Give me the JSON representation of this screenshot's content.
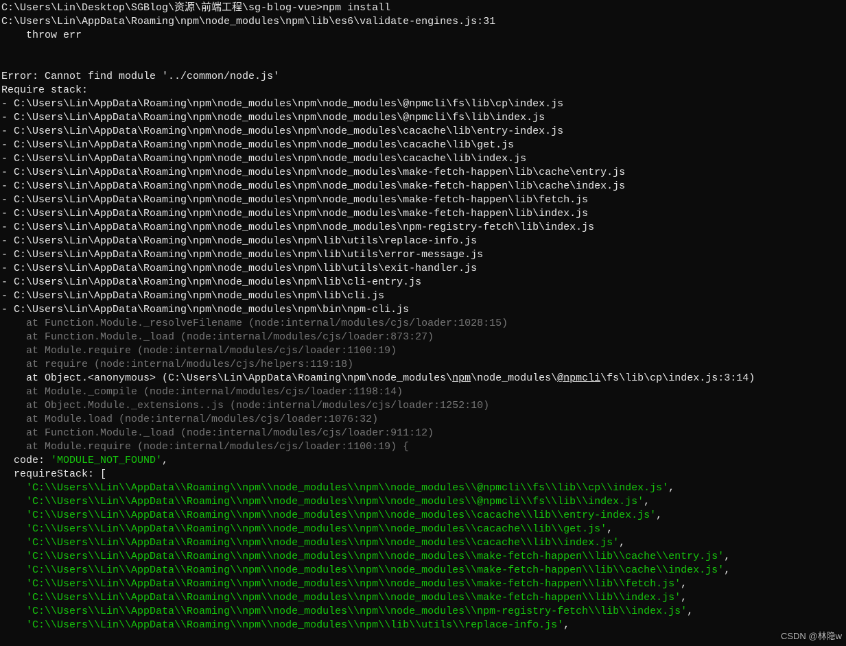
{
  "prompt_path": "C:\\Users\\Lin\\Desktop\\SGBlog\\资源\\前端工程\\sg-blog-vue>",
  "command": "npm install",
  "engine_line": "C:\\Users\\Lin\\AppData\\Roaming\\npm\\node_modules\\npm\\lib\\es6\\validate-engines.js:31",
  "throw_line": "    throw err",
  "error_line": "Error: Cannot find module '../common/node.js'",
  "require_stack_header": "Require stack:",
  "stack_files": [
    "- C:\\Users\\Lin\\AppData\\Roaming\\npm\\node_modules\\npm\\node_modules\\@npmcli\\fs\\lib\\cp\\index.js",
    "- C:\\Users\\Lin\\AppData\\Roaming\\npm\\node_modules\\npm\\node_modules\\@npmcli\\fs\\lib\\index.js",
    "- C:\\Users\\Lin\\AppData\\Roaming\\npm\\node_modules\\npm\\node_modules\\cacache\\lib\\entry-index.js",
    "- C:\\Users\\Lin\\AppData\\Roaming\\npm\\node_modules\\npm\\node_modules\\cacache\\lib\\get.js",
    "- C:\\Users\\Lin\\AppData\\Roaming\\npm\\node_modules\\npm\\node_modules\\cacache\\lib\\index.js",
    "- C:\\Users\\Lin\\AppData\\Roaming\\npm\\node_modules\\npm\\node_modules\\make-fetch-happen\\lib\\cache\\entry.js",
    "- C:\\Users\\Lin\\AppData\\Roaming\\npm\\node_modules\\npm\\node_modules\\make-fetch-happen\\lib\\cache\\index.js",
    "- C:\\Users\\Lin\\AppData\\Roaming\\npm\\node_modules\\npm\\node_modules\\make-fetch-happen\\lib\\fetch.js",
    "- C:\\Users\\Lin\\AppData\\Roaming\\npm\\node_modules\\npm\\node_modules\\make-fetch-happen\\lib\\index.js",
    "- C:\\Users\\Lin\\AppData\\Roaming\\npm\\node_modules\\npm\\node_modules\\npm-registry-fetch\\lib\\index.js",
    "- C:\\Users\\Lin\\AppData\\Roaming\\npm\\node_modules\\npm\\lib\\utils\\replace-info.js",
    "- C:\\Users\\Lin\\AppData\\Roaming\\npm\\node_modules\\npm\\lib\\utils\\error-message.js",
    "- C:\\Users\\Lin\\AppData\\Roaming\\npm\\node_modules\\npm\\lib\\utils\\exit-handler.js",
    "- C:\\Users\\Lin\\AppData\\Roaming\\npm\\node_modules\\npm\\lib\\cli-entry.js",
    "- C:\\Users\\Lin\\AppData\\Roaming\\npm\\node_modules\\npm\\lib\\cli.js",
    "- C:\\Users\\Lin\\AppData\\Roaming\\npm\\node_modules\\npm\\bin\\npm-cli.js"
  ],
  "trace": [
    "    at Function.Module._resolveFilename (node:internal/modules/cjs/loader:1028:15)",
    "    at Function.Module._load (node:internal/modules/cjs/loader:873:27)",
    "    at Module.require (node:internal/modules/cjs/loader:1100:19)",
    "    at require (node:internal/modules/cjs/helpers:119:18)"
  ],
  "anon": {
    "pre": "    at Object.<anonymous> (C:\\Users\\Lin\\AppData\\Roaming\\npm\\node_modules\\",
    "link1": "npm",
    "mid": "\\node_modules\\",
    "link2": "@npmcli",
    "post": "\\fs\\lib\\cp\\index.js:3:14)"
  },
  "trace2": [
    "    at Module._compile (node:internal/modules/cjs/loader:1198:14)",
    "    at Object.Module._extensions..js (node:internal/modules/cjs/loader:1252:10)",
    "    at Module.load (node:internal/modules/cjs/loader:1076:32)",
    "    at Function.Module._load (node:internal/modules/cjs/loader:911:12)",
    "    at Module.require (node:internal/modules/cjs/loader:1100:19) {"
  ],
  "code_label": "  code: ",
  "code_value": "'MODULE_NOT_FOUND'",
  "code_tail": ",",
  "require_stack_line": "  requireStack: [",
  "require_stack_items": [
    "'C:\\\\Users\\\\Lin\\\\AppData\\\\Roaming\\\\npm\\\\node_modules\\\\npm\\\\node_modules\\\\@npmcli\\\\fs\\\\lib\\\\cp\\\\index.js'",
    "'C:\\\\Users\\\\Lin\\\\AppData\\\\Roaming\\\\npm\\\\node_modules\\\\npm\\\\node_modules\\\\@npmcli\\\\fs\\\\lib\\\\index.js'",
    "'C:\\\\Users\\\\Lin\\\\AppData\\\\Roaming\\\\npm\\\\node_modules\\\\npm\\\\node_modules\\\\cacache\\\\lib\\\\entry-index.js'",
    "'C:\\\\Users\\\\Lin\\\\AppData\\\\Roaming\\\\npm\\\\node_modules\\\\npm\\\\node_modules\\\\cacache\\\\lib\\\\get.js'",
    "'C:\\\\Users\\\\Lin\\\\AppData\\\\Roaming\\\\npm\\\\node_modules\\\\npm\\\\node_modules\\\\cacache\\\\lib\\\\index.js'",
    "'C:\\\\Users\\\\Lin\\\\AppData\\\\Roaming\\\\npm\\\\node_modules\\\\npm\\\\node_modules\\\\make-fetch-happen\\\\lib\\\\cache\\\\entry.js'",
    "'C:\\\\Users\\\\Lin\\\\AppData\\\\Roaming\\\\npm\\\\node_modules\\\\npm\\\\node_modules\\\\make-fetch-happen\\\\lib\\\\cache\\\\index.js'",
    "'C:\\\\Users\\\\Lin\\\\AppData\\\\Roaming\\\\npm\\\\node_modules\\\\npm\\\\node_modules\\\\make-fetch-happen\\\\lib\\\\fetch.js'",
    "'C:\\\\Users\\\\Lin\\\\AppData\\\\Roaming\\\\npm\\\\node_modules\\\\npm\\\\node_modules\\\\make-fetch-happen\\\\lib\\\\index.js'",
    "'C:\\\\Users\\\\Lin\\\\AppData\\\\Roaming\\\\npm\\\\node_modules\\\\npm\\\\node_modules\\\\npm-registry-fetch\\\\lib\\\\index.js'",
    "'C:\\\\Users\\\\Lin\\\\AppData\\\\Roaming\\\\npm\\\\node_modules\\\\npm\\\\lib\\\\utils\\\\replace-info.js'"
  ],
  "indent_item": "    ",
  "comma": ",",
  "watermark": "CSDN @林隐w"
}
